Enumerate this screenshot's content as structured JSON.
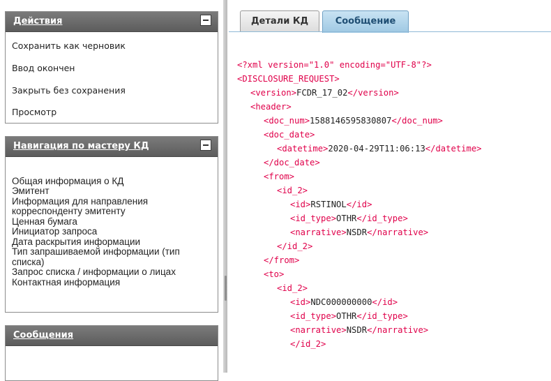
{
  "sidebar": {
    "actions_panel": {
      "title": "Действия",
      "items": [
        "Сохранить как черновик",
        "Ввод окончен",
        "Закрыть без сохранения",
        "Просмотр"
      ]
    },
    "nav_panel": {
      "title": "Навигация по мастеру КД",
      "items": [
        "Общая информация о КД",
        "Эмитент",
        "Информация для направления",
        "корреспонденту эмитенту",
        "Ценная бумага",
        "Инициатор запроса",
        "Дата раскрытия информации",
        "Тип запрашиваемой информации (тип",
        "списка)",
        "Запрос списка / информации о лицах",
        "Контактная информация"
      ]
    },
    "messages_panel": {
      "title": "Сообщения"
    }
  },
  "tabs": [
    {
      "label": "Детали КД",
      "active": false
    },
    {
      "label": "Сообщение",
      "active": true
    }
  ],
  "xml_lines": [
    {
      "indent": 0,
      "open": "<?xml version=\"1.0\" encoding=\"UTF-8\"?>",
      "text": "",
      "close": ""
    },
    {
      "indent": 0,
      "open": "<DISCLOSURE_REQUEST>",
      "text": "",
      "close": ""
    },
    {
      "indent": 1,
      "open": "<version>",
      "text": "FCDR_17_02",
      "close": "</version>"
    },
    {
      "indent": 1,
      "open": "<header>",
      "text": "",
      "close": ""
    },
    {
      "indent": 2,
      "open": "<doc_num>",
      "text": "1588146595830807",
      "close": "</doc_num>"
    },
    {
      "indent": 2,
      "open": "<doc_date>",
      "text": "",
      "close": ""
    },
    {
      "indent": 3,
      "open": "<datetime>",
      "text": "2020-04-29T11:06:13",
      "close": "</datetime>"
    },
    {
      "indent": 2,
      "open": "</doc_date>",
      "text": "",
      "close": ""
    },
    {
      "indent": 2,
      "open": "<from>",
      "text": "",
      "close": ""
    },
    {
      "indent": 3,
      "open": "<id_2>",
      "text": "",
      "close": ""
    },
    {
      "indent": 4,
      "open": "<id>",
      "text": "RSTINOL",
      "close": "</id>"
    },
    {
      "indent": 4,
      "open": "<id_type>",
      "text": "OTHR",
      "close": "</id_type>"
    },
    {
      "indent": 4,
      "open": "<narrative>",
      "text": "NSDR",
      "close": "</narrative>"
    },
    {
      "indent": 3,
      "open": "</id_2>",
      "text": "",
      "close": ""
    },
    {
      "indent": 2,
      "open": "</from>",
      "text": "",
      "close": ""
    },
    {
      "indent": 2,
      "open": "<to>",
      "text": "",
      "close": ""
    },
    {
      "indent": 3,
      "open": "<id_2>",
      "text": "",
      "close": ""
    },
    {
      "indent": 4,
      "open": "<id>",
      "text": "NDC000000000",
      "close": "</id>"
    },
    {
      "indent": 4,
      "open": "<id_type>",
      "text": "OTHR",
      "close": "</id_type>"
    },
    {
      "indent": 4,
      "open": "<narrative>",
      "text": "NSDR",
      "close": "</narrative>"
    },
    {
      "indent": 4,
      "open": "</id_2>",
      "text": "",
      "close": ""
    }
  ],
  "colors": {
    "xml_tag": "#e0004a",
    "xml_text": "#222222",
    "active_tab": "#9ec8e3",
    "panel_header": "#6b6b6b"
  },
  "icons": {
    "collapse": "minus-square-icon"
  }
}
